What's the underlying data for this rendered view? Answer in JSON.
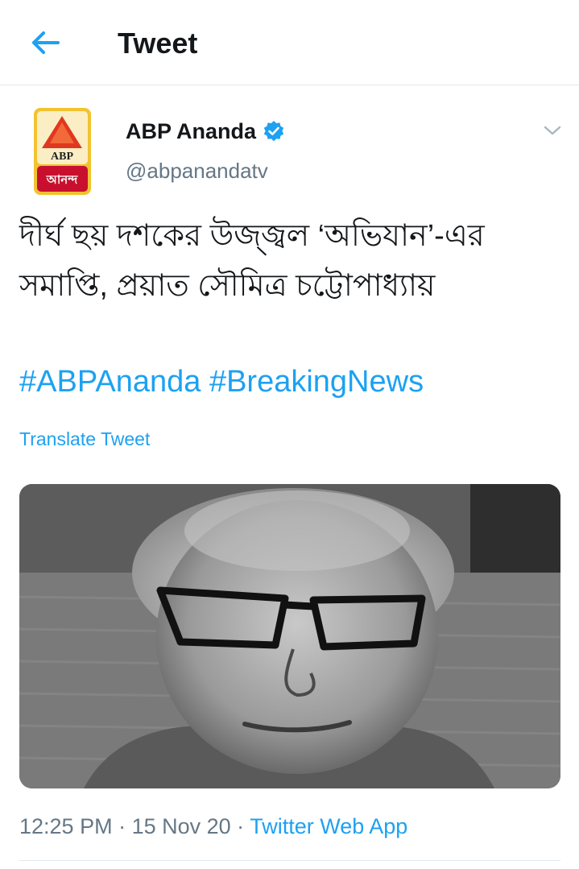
{
  "header": {
    "title": "Tweet"
  },
  "author": {
    "avatar_text_top": "ABP",
    "avatar_text_bottom": "আনন্দ",
    "display_name": "ABP Ananda",
    "handle": "@abpanandatv",
    "verified": true
  },
  "tweet": {
    "text_line1": "দীর্ঘ ছয় দশকের উজ্জ্বল ‘অভিযান’-এর",
    "text_line2": "সমাপ্তি, প্রয়াত সৌমিত্র চট্টোপাধ্যায়",
    "hashtags": [
      "#ABPAnanda",
      "#BreakingNews"
    ],
    "translate_label": "Translate Tweet"
  },
  "meta": {
    "time": "12:25 PM",
    "separator": " · ",
    "date": "15 Nov 20",
    "source": "Twitter Web App"
  },
  "colors": {
    "accent": "#1da1f2",
    "secondary_text": "#657786",
    "avatar_red": "#c8102e",
    "avatar_gold": "#f2c230"
  },
  "icons": {
    "back": "back-arrow-icon",
    "verified": "verified-badge-icon",
    "caret": "chevron-down-icon"
  }
}
